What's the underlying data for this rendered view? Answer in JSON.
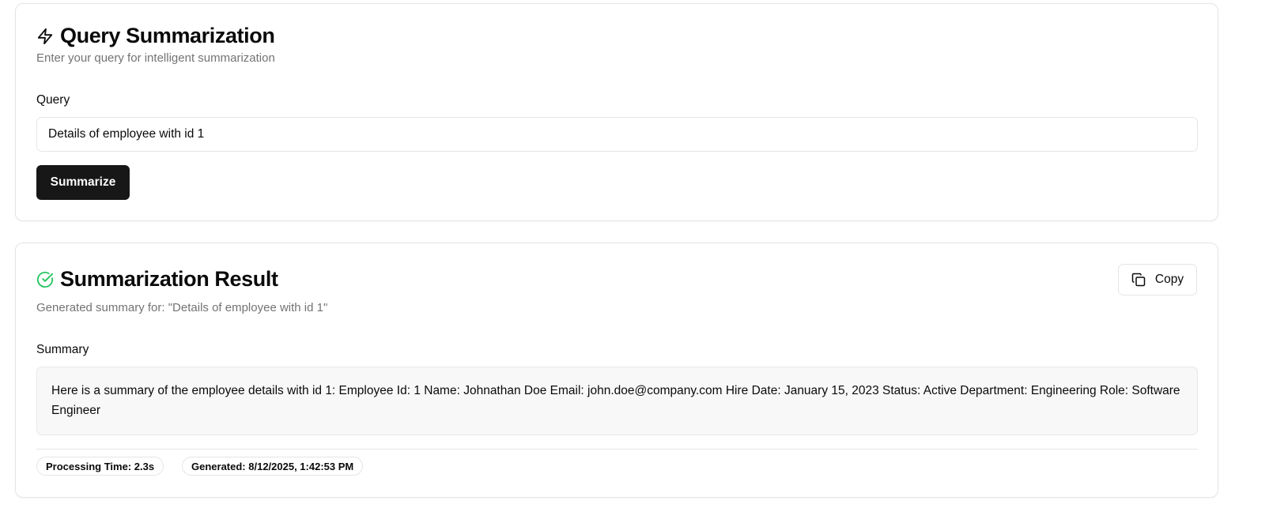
{
  "query_card": {
    "title": "Query Summarization",
    "subtitle": "Enter your query for intelligent summarization",
    "query_label": "Query",
    "query_value": "Details of employee with id 1",
    "summarize_label": "Summarize",
    "icon": "lightning-icon"
  },
  "result_card": {
    "title": "Summarization Result",
    "subtitle": "Generated summary for: \"Details of employee with id 1\"",
    "copy_label": "Copy",
    "summary_label": "Summary",
    "summary_text": "Here is a summary of the employee details with id 1: Employee Id: 1 Name: Johnathan Doe Email: john.doe@company.com Hire Date: January 15, 2023 Status: Active Department: Engineering Role: Software Engineer",
    "processing_time": "Processing Time: 2.3s",
    "generated": "Generated: 8/12/2025, 1:42:53 PM",
    "status_icon": "check-circle-icon",
    "copy_icon": "copy-icon"
  },
  "colors": {
    "primary_button": "#171717",
    "success": "#22c55e",
    "muted_text": "#737373",
    "border": "#e5e5e5"
  }
}
